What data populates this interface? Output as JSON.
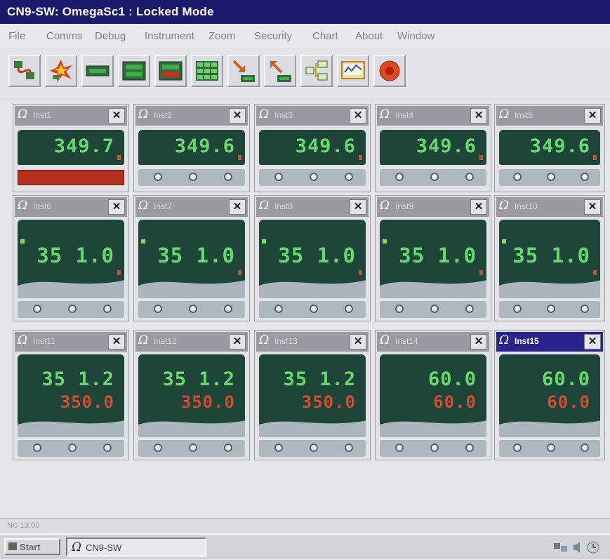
{
  "window": {
    "title": "CN9-SW: OmegaSc1 : Locked Mode"
  },
  "menu": [
    "File",
    "Comms",
    "Debug",
    "Instrument",
    "Zoom",
    "Security",
    "Chart",
    "About",
    "Window"
  ],
  "toolbar": [
    {
      "icon": "connect-icon"
    },
    {
      "icon": "burst-icon"
    },
    {
      "icon": "single-display-icon"
    },
    {
      "icon": "dual-display-icon"
    },
    {
      "icon": "large-display-icon"
    },
    {
      "icon": "grid-icon"
    },
    {
      "icon": "download-icon"
    },
    {
      "icon": "upload-icon"
    },
    {
      "icon": "network-icon"
    },
    {
      "icon": "chart-icon"
    },
    {
      "icon": "stop-icon"
    }
  ],
  "omega_symbol": "Ω",
  "close_glyph": "✕",
  "instruments_row1": [
    {
      "name": "Inst1",
      "pv": "349.7",
      "alarm": true
    },
    {
      "name": "Inst2",
      "pv": "349.6"
    },
    {
      "name": "Inst3",
      "pv": "349.6"
    },
    {
      "name": "Inst4",
      "pv": "349.6"
    },
    {
      "name": "Inst5",
      "pv": "349.6"
    }
  ],
  "instruments_row2": [
    {
      "name": "Inst6",
      "pv": "35 1.0"
    },
    {
      "name": "Inst7",
      "pv": "35 1.0"
    },
    {
      "name": "Inst8",
      "pv": "35 1.0"
    },
    {
      "name": "Inst9",
      "pv": "35 1.0"
    },
    {
      "name": "Inst10",
      "pv": "35 1.0"
    }
  ],
  "instruments_row3": [
    {
      "name": "Inst11",
      "pv": "35 1.2",
      "sv": "350.0"
    },
    {
      "name": "Inst12",
      "pv": "35 1.2",
      "sv": "350.0"
    },
    {
      "name": "Inst13",
      "pv": "35 1.2",
      "sv": "350.0"
    },
    {
      "name": "Inst14",
      "pv": "60.0",
      "sv": "60.0"
    },
    {
      "name": "Inst15",
      "pv": "60.0",
      "sv": "60.0",
      "active": true
    }
  ],
  "status_bar": {
    "text": "NC  13:00"
  },
  "taskbar": {
    "start_label": "Start",
    "task_label": "CN9-SW"
  },
  "colors": {
    "titlebar": "#1d1a6e",
    "display_bg": "#1d4538",
    "pv_green": "#66d86f",
    "sv_red": "#d74a33",
    "alarm_red": "#b5301f"
  }
}
